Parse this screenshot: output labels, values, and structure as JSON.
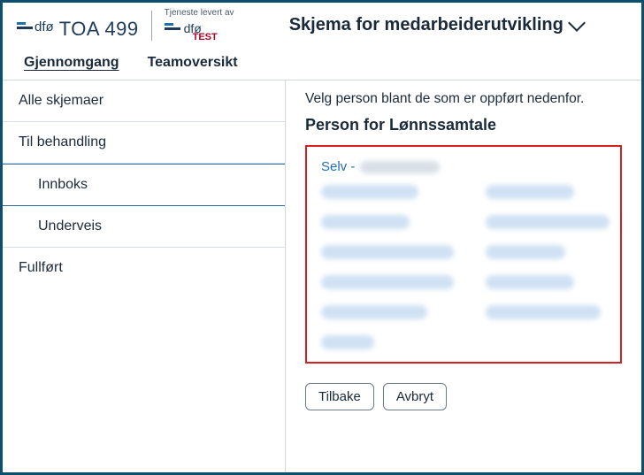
{
  "header": {
    "brand_dfo": "dfø",
    "brand_toa": "TOA 499",
    "tjeneste_label": "Tjeneste levert av",
    "brand_dfo2": "dfø",
    "test_tag": "TEST",
    "title": "Skjema for medarbeiderutvikling"
  },
  "tabs": {
    "active": "Gjennomgang",
    "items": [
      "Gjennomgang",
      "Teamoversikt"
    ]
  },
  "sidebar": {
    "items": [
      {
        "label": "Alle skjemaer",
        "level": 0,
        "selected": false
      },
      {
        "label": "Til behandling",
        "level": 0,
        "selected": false
      },
      {
        "label": "Innboks",
        "level": 1,
        "selected": true
      },
      {
        "label": "Underveis",
        "level": 1,
        "selected": false
      },
      {
        "label": "Fullført",
        "level": 0,
        "selected": false
      }
    ]
  },
  "main": {
    "hint": "Velg person blant de som er oppført nedenfor.",
    "section_title": "Person for Lønnssamtale",
    "selv_prefix": "Selv - ",
    "buttons": {
      "back": "Tilbake",
      "cancel": "Avbryt"
    }
  }
}
